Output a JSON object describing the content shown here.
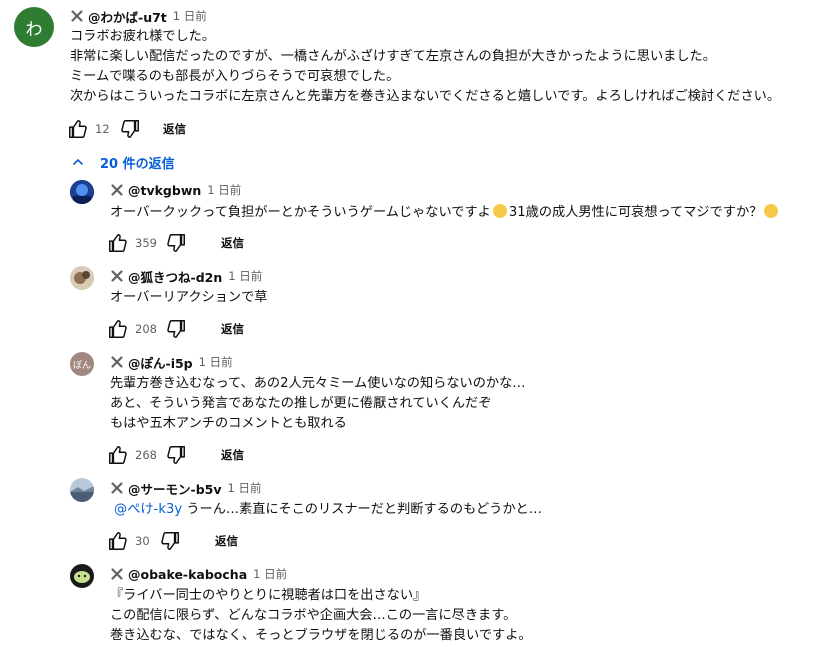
{
  "top_comment": {
    "avatar_letter": "わ",
    "author": "@わかば-u7t",
    "time": "1 日前",
    "lines": [
      "コラボお疲れ様でした。",
      "非常に楽しい配信だったのですが、一橋さんがふざけすぎて左京さんの負担が大きかったように思いました。",
      "ミームで喋るのも部長が入りづらそうで可哀想でした。",
      "次からはこういったコラボに左京さんと先輩方を巻き込まないでくださると嬉しいです。よろしければご検討ください。"
    ],
    "likes": "12",
    "reply_label": "返信",
    "avatar_color": "#2e7d32"
  },
  "replies_toggle": {
    "label": "20 件の返信"
  },
  "replies": [
    {
      "author": "@tvkgbwn",
      "time": "1 日前",
      "text_a": "オーバークックって負担がーとかそういうゲームじゃないですよ",
      "text_b": "31歳の成人男性に可哀想ってマジですか？",
      "likes": "359",
      "reply_label": "返信",
      "avatar_icon": "avatar-blue-photo"
    },
    {
      "author": "@狐きつね-d2n",
      "time": "1 日前",
      "lines": [
        "オーバーリアクションで草"
      ],
      "likes": "208",
      "reply_label": "返信",
      "avatar_icon": "avatar-fox-photo"
    },
    {
      "author": "@ぽん-i5p",
      "time": "1 日前",
      "avatar_text": "ぽん",
      "lines": [
        "先輩方巻き込むなって、あの2人元々ミーム使いなの知らないのかな…",
        "あと、そういう発言であなたの推しが更に倦厭されていくんだぞ",
        "もはや五木アンチのコメントとも取れる"
      ],
      "likes": "268",
      "reply_label": "返信",
      "avatar_color": "#a1887f"
    },
    {
      "author": "@サーモン-b5v",
      "time": "1 日前",
      "mention": "@ぺけ-k3y",
      "text": " うーん…素直にそこのリスナーだと判断するのもどうかと…",
      "likes": "30",
      "reply_label": "返信",
      "avatar_icon": "avatar-landscape-photo"
    },
    {
      "author": "@obake-kabocha",
      "time": "1 日前",
      "lines": [
        "『ライバー同士のやりとりに視聴者は口を出さない』",
        "この配信に限らず、どんなコラボや企画大会…この一言に尽きます。",
        "巻き込むな、ではなく、そっとブラウザを閉じるのが一番良いですよ。"
      ],
      "avatar_icon": "avatar-green-blob"
    }
  ]
}
